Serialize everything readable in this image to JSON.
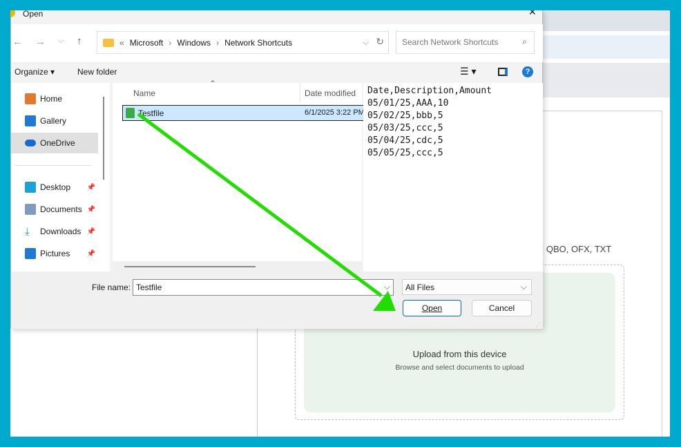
{
  "dialog": {
    "title": "Open",
    "close": "✕",
    "breadcrumb": {
      "overflow": "«",
      "items": [
        "Microsoft",
        "Windows",
        "Network Shortcuts"
      ]
    },
    "search_placeholder": "Search Network Shortcuts",
    "toolbar": {
      "organize": "Organize ▾",
      "new_folder": "New folder"
    },
    "nav": [
      {
        "label": "Home",
        "color": "#e07a2f"
      },
      {
        "label": "Gallery",
        "color": "#1f7ad6"
      },
      {
        "label": "OneDrive",
        "color": "#1769d1"
      },
      {
        "label": "Desktop",
        "color": "#1ba3d8"
      },
      {
        "label": "Documents",
        "color": "#7f9cc0"
      },
      {
        "label": "Downloads",
        "color": "#17a38c"
      },
      {
        "label": "Pictures",
        "color": "#1f7ad6"
      }
    ],
    "columns": {
      "name": "Name",
      "date": "Date modified"
    },
    "files": [
      {
        "name": "Testfile",
        "date": "6/1/2025 3:22 PM"
      }
    ],
    "preview": [
      "Date,Description,Amount",
      "05/01/25,AAA,10",
      "05/02/25,bbb,5",
      "05/03/25,ccc,5",
      "05/04/25,cdc,5",
      "05/05/25,ccc,5"
    ],
    "file_name_label": "File name:",
    "file_name_value": "Testfile",
    "file_type": "All Files",
    "open": "Open",
    "cancel": "Cancel"
  },
  "background": {
    "formats": "X, QBO, OFX, TXT",
    "upload_title": "Upload from this device",
    "upload_sub": "Browse and select documents to upload"
  },
  "colors": {
    "frame": "#00a9ce",
    "arrow": "#22dd00",
    "accent": "#0067c0"
  }
}
